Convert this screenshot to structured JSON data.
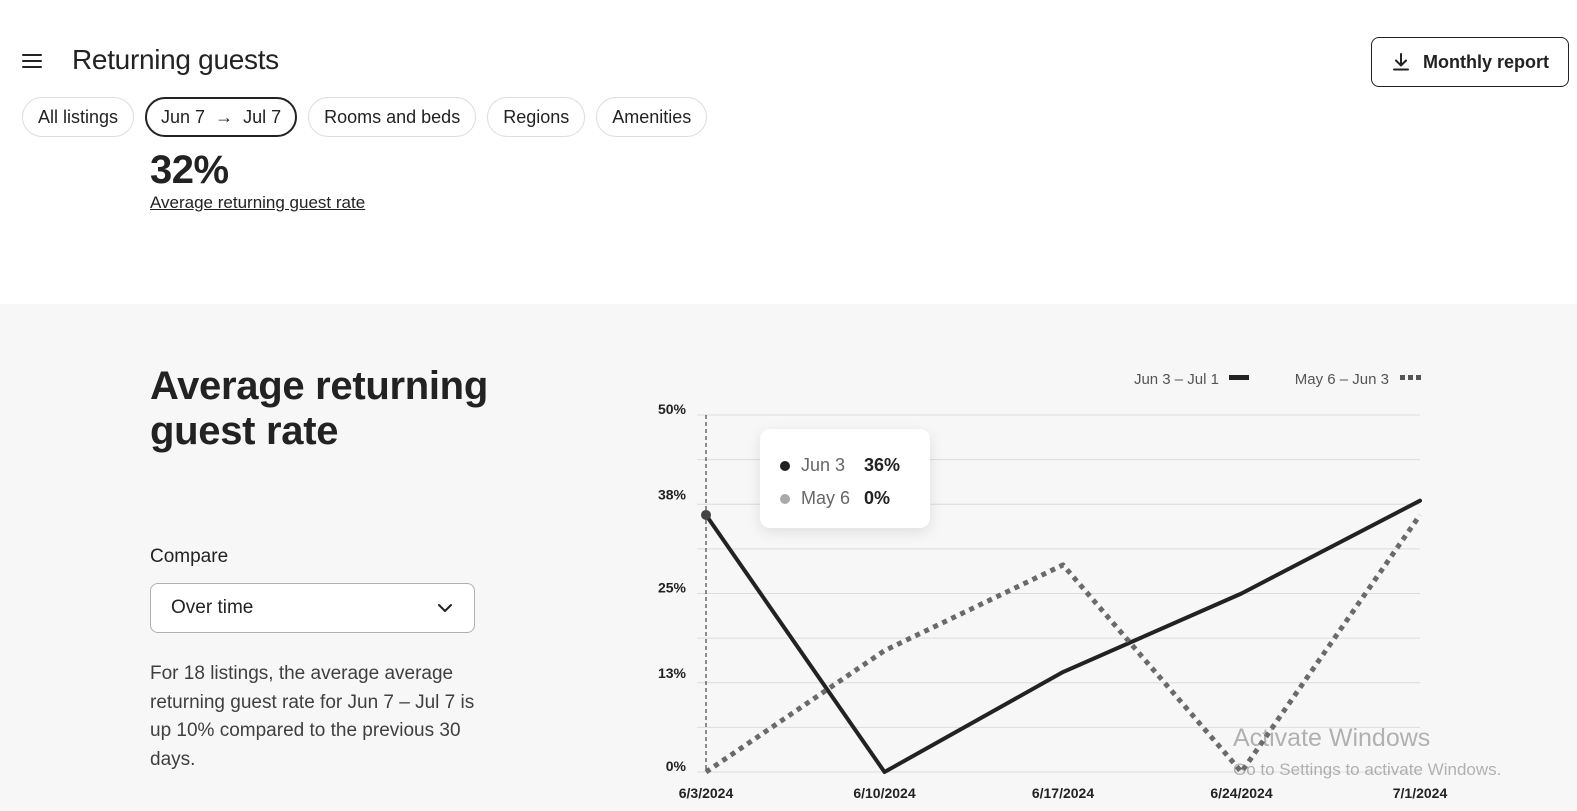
{
  "header": {
    "title": "Returning guests",
    "report_button": "Monthly report"
  },
  "filters": {
    "all_listings": "All listings",
    "date_start": "Jun 7",
    "date_arrow": "→",
    "date_end": "Jul 7",
    "rooms": "Rooms and beds",
    "regions": "Regions",
    "amenities": "Amenities"
  },
  "kpi": {
    "value": "32%",
    "label": "Average returning guest rate"
  },
  "section": {
    "title": "Average returning guest rate",
    "compare_label": "Compare",
    "compare_value": "Over time",
    "summary": "For 18 listings, the average average returning guest rate for Jun 7 – Jul 7 is up 10% compared to the previous 30 days."
  },
  "tooltip": {
    "rows": [
      {
        "date": "Jun 3",
        "value": "36%"
      },
      {
        "date": "May 6",
        "value": "0%"
      }
    ]
  },
  "watermark": {
    "line1": "Activate Windows",
    "line2": "Go to Settings to activate Windows."
  },
  "colors": {
    "current": "#222222",
    "previous": "#6a6a6a",
    "tooltip_previous_dot": "#aaaaaa"
  },
  "chart_data": {
    "type": "line",
    "x": [
      "6/3/2024",
      "6/10/2024",
      "6/17/2024",
      "6/24/2024",
      "7/1/2024"
    ],
    "y_ticks": [
      "50%",
      "38%",
      "25%",
      "13%",
      "0%"
    ],
    "y_tick_values": [
      50,
      38,
      25,
      13,
      0
    ],
    "ylim": [
      0,
      50
    ],
    "grid": true,
    "legend_position": "top-right",
    "series": [
      {
        "name": "Jun 3 – Jul 1",
        "style": "solid",
        "values": [
          36,
          0,
          14,
          25,
          38
        ]
      },
      {
        "name": "May 6 – Jun 3",
        "style": "dotted",
        "values": [
          0,
          17,
          29,
          0,
          36
        ]
      }
    ],
    "highlight": {
      "x": "6/3/2024"
    }
  }
}
